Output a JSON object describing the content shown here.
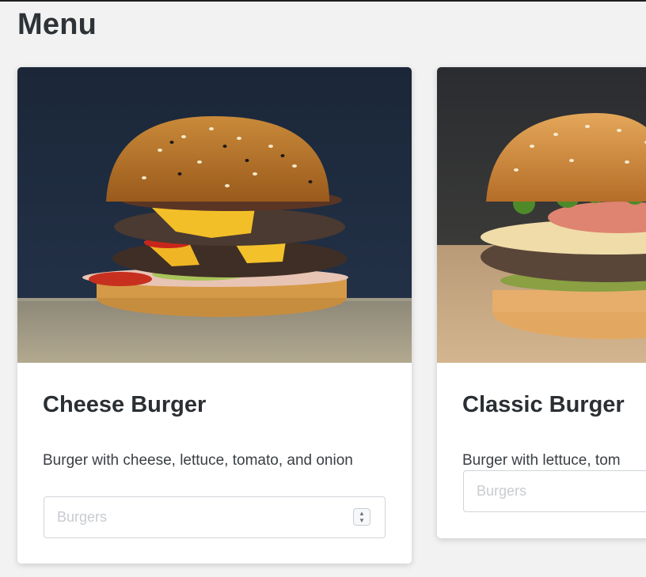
{
  "page": {
    "title": "Menu"
  },
  "cards": [
    {
      "title": "Cheese Burger",
      "description": "Burger with cheese, lettuce, tomato, and onion",
      "input_placeholder": "Burgers",
      "image_icon": "burger-photo-icon"
    },
    {
      "title": "Classic Burger",
      "description": "Burger with lettuce, tom",
      "input_placeholder": "Burgers",
      "image_icon": "burger-photo-icon"
    }
  ],
  "colors": {
    "background": "#f2f2f2",
    "card": "#ffffff",
    "title_text": "#2e3338",
    "placeholder": "#c8ccd0"
  }
}
